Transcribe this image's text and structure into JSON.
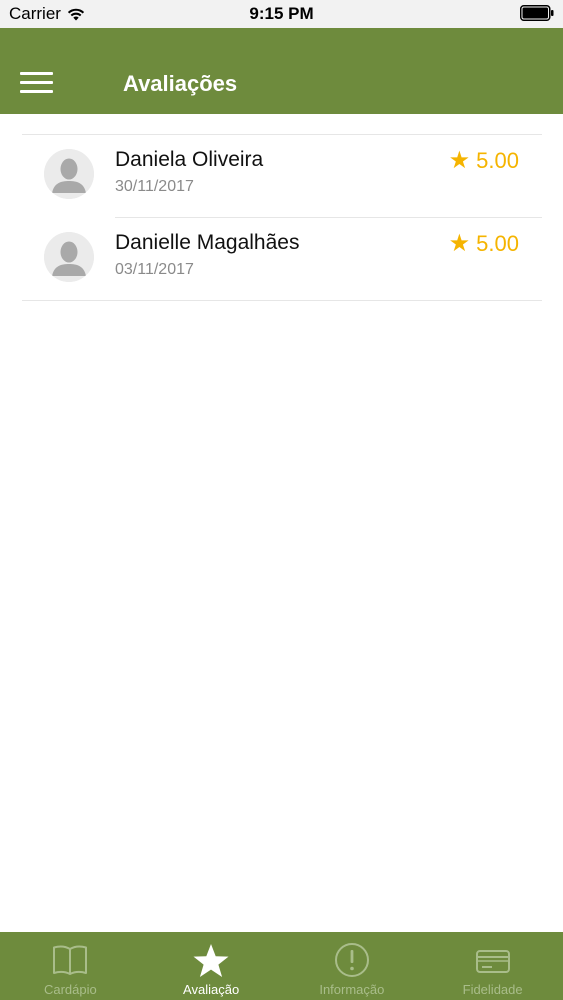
{
  "status_bar": {
    "carrier": "Carrier",
    "time": "9:15 PM"
  },
  "header": {
    "title": "Avaliações",
    "menu_icon": "hamburger-menu-icon"
  },
  "reviews": [
    {
      "name": "Daniela Oliveira",
      "date": "30/11/2017",
      "rating": "5.00",
      "stars": 5
    },
    {
      "name": "Danielle Magalhães",
      "date": "03/11/2017",
      "rating": "5.00",
      "stars": 5
    }
  ],
  "tab_bar": {
    "tabs": [
      {
        "label": "Cardápio",
        "icon": "book-icon",
        "active": false
      },
      {
        "label": "Avaliação",
        "icon": "star-icon",
        "active": true
      },
      {
        "label": "Informação",
        "icon": "info-exclamation-icon",
        "active": false
      },
      {
        "label": "Fidelidade",
        "icon": "card-icon",
        "active": false
      }
    ]
  },
  "colors": {
    "brand_green": "#6e8b3d",
    "star_gold": "#f5b400",
    "tab_inactive": "#a9bd8a",
    "tab_active": "#ffffff"
  }
}
